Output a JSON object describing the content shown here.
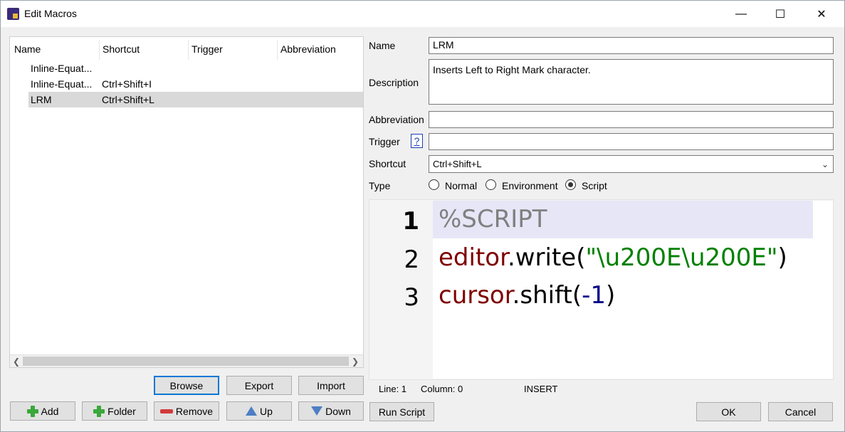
{
  "window": {
    "title": "Edit Macros",
    "min_icon": "minimize-icon",
    "max_icon": "maximize-icon",
    "close_icon": "close-icon"
  },
  "list": {
    "columns": [
      "Name",
      "Shortcut",
      "Trigger",
      "Abbreviation"
    ],
    "rows": [
      {
        "name": "Inline-Equat...",
        "shortcut": "",
        "trigger": "",
        "abbreviation": ""
      },
      {
        "name": "Inline-Equat...",
        "shortcut": "Ctrl+Shift+I",
        "trigger": "",
        "abbreviation": ""
      },
      {
        "name": "LRM",
        "shortcut": "Ctrl+Shift+L",
        "trigger": "",
        "abbreviation": ""
      }
    ],
    "selected_index": 2
  },
  "buttons": {
    "browse": "Browse",
    "export": "Export",
    "import": "Import",
    "add": "Add",
    "folder": "Folder",
    "remove": "Remove",
    "up": "Up",
    "down": "Down",
    "run_script": "Run Script",
    "ok": "OK",
    "cancel": "Cancel"
  },
  "form": {
    "name_label": "Name",
    "name_value": "LRM",
    "description_label": "Description",
    "description_value": "Inserts Left to Right Mark character.",
    "abbreviation_label": "Abbreviation",
    "abbreviation_value": "",
    "trigger_label": "Trigger",
    "trigger_help": "?",
    "trigger_value": "",
    "shortcut_label": "Shortcut",
    "shortcut_value": "Ctrl+Shift+L",
    "type_label": "Type",
    "type_options": [
      "Normal",
      "Environment",
      "Script"
    ],
    "type_selected": "Script"
  },
  "editor": {
    "line_numbers": [
      "1",
      "2",
      "3"
    ],
    "line1": "%SCRIPT",
    "line2": {
      "obj": "editor",
      "dot": ".write(",
      "str": "\"\\u200E\\u200E\"",
      "close": ")"
    },
    "line3": {
      "obj": "cursor",
      "dot": ".shift(",
      "num": "-1",
      "close": ")"
    }
  },
  "status": {
    "line": "Line: 1",
    "column": "Column: 0",
    "mode": "INSERT"
  },
  "colors": {
    "accent": "#0078d7",
    "selection": "#d9d9d9",
    "current_line": "#e6e6f7"
  }
}
